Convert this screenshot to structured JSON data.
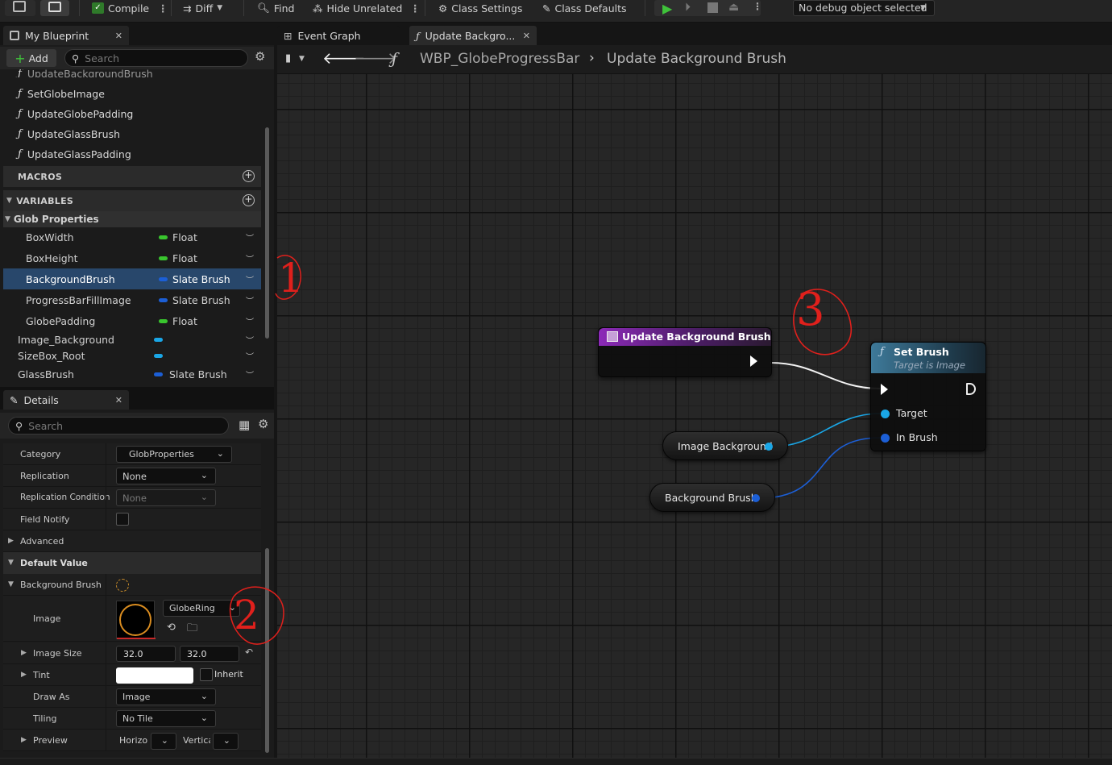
{
  "toolbar": {
    "compile": "Compile",
    "diff": "Diff",
    "find": "Find",
    "hide_unrelated": "Hide Unrelated",
    "class_settings": "Class Settings",
    "class_defaults": "Class Defaults",
    "debug_select": "No debug object selected"
  },
  "my_blueprint": {
    "tab_title": "My Blueprint",
    "add_label": "Add",
    "search_placeholder": "Search",
    "partial_item": "UpdateBackgroundBrush",
    "functions": [
      "SetGlobeImage",
      "UpdateGlobePadding",
      "UpdateGlassBrush",
      "UpdateGlassPadding"
    ],
    "macros_header": "MACROS",
    "variables_header": "VARIABLES",
    "category": "Glob Properties",
    "variables": [
      {
        "name": "BoxWidth",
        "type": "Float",
        "color": "#39c52e"
      },
      {
        "name": "BoxHeight",
        "type": "Float",
        "color": "#39c52e"
      },
      {
        "name": "BackgroundBrush",
        "type": "Slate Brush",
        "color": "#1c5fd6"
      },
      {
        "name": "ProgressBarFillImage",
        "type": "Slate Brush",
        "color": "#1c5fd6"
      },
      {
        "name": "GlobePadding",
        "type": "Float",
        "color": "#39c52e"
      },
      {
        "name": "Image_Background",
        "type": "",
        "color": "#1aa6e6"
      },
      {
        "name": "SizeBox_Root",
        "type": "",
        "color": "#1aa6e6"
      },
      {
        "name": "GlassBrush",
        "type": "Slate Brush",
        "color": "#1c5fd6"
      }
    ]
  },
  "details": {
    "tab_title": "Details",
    "search_placeholder": "Search",
    "category_label": "Category",
    "category_value": "GlobProperties",
    "replication_label": "Replication",
    "replication_value": "None",
    "replication_condition_label": "Replication Condition",
    "replication_condition_value": "None",
    "field_notify_label": "Field Notify",
    "advanced_label": "Advanced",
    "default_value_label": "Default Value",
    "background_brush_label": "Background Brush",
    "image_label": "Image",
    "image_asset": "GlobeRing",
    "image_size_label": "Image Size",
    "image_size_x": "32.0",
    "image_size_y": "32.0",
    "tint_label": "Tint",
    "inherit_label": "Inherit",
    "draw_as_label": "Draw As",
    "draw_as_value": "Image",
    "tiling_label": "Tiling",
    "tiling_value": "No Tile",
    "preview_label": "Preview",
    "preview_h": "Horizo",
    "preview_v": "Vertica"
  },
  "graph": {
    "tab_event_graph": "Event Graph",
    "tab_update": "Update Backgro...",
    "breadcrumb_bp": "WBP_GlobeProgressBar",
    "breadcrumb_fn": "Update Background Brush",
    "entry_node_title": "Update Background Brush",
    "set_brush_title": "Set Brush",
    "set_brush_subtitle": "Target is Image",
    "pin_target": "Target",
    "pin_in_brush": "In Brush",
    "var_image_background": "Image Background",
    "var_background_brush": "Background Brush"
  },
  "annotations": [
    "1",
    "2",
    "3"
  ],
  "colors": {
    "float_pin": "#39c52e",
    "brush_pin": "#1c5fd6",
    "object_pin": "#1aa6e6",
    "entry_header": "#7b1fa2",
    "call_header": "#3c6e8a",
    "selection": "#28476b",
    "annotation": "#e0201c"
  }
}
